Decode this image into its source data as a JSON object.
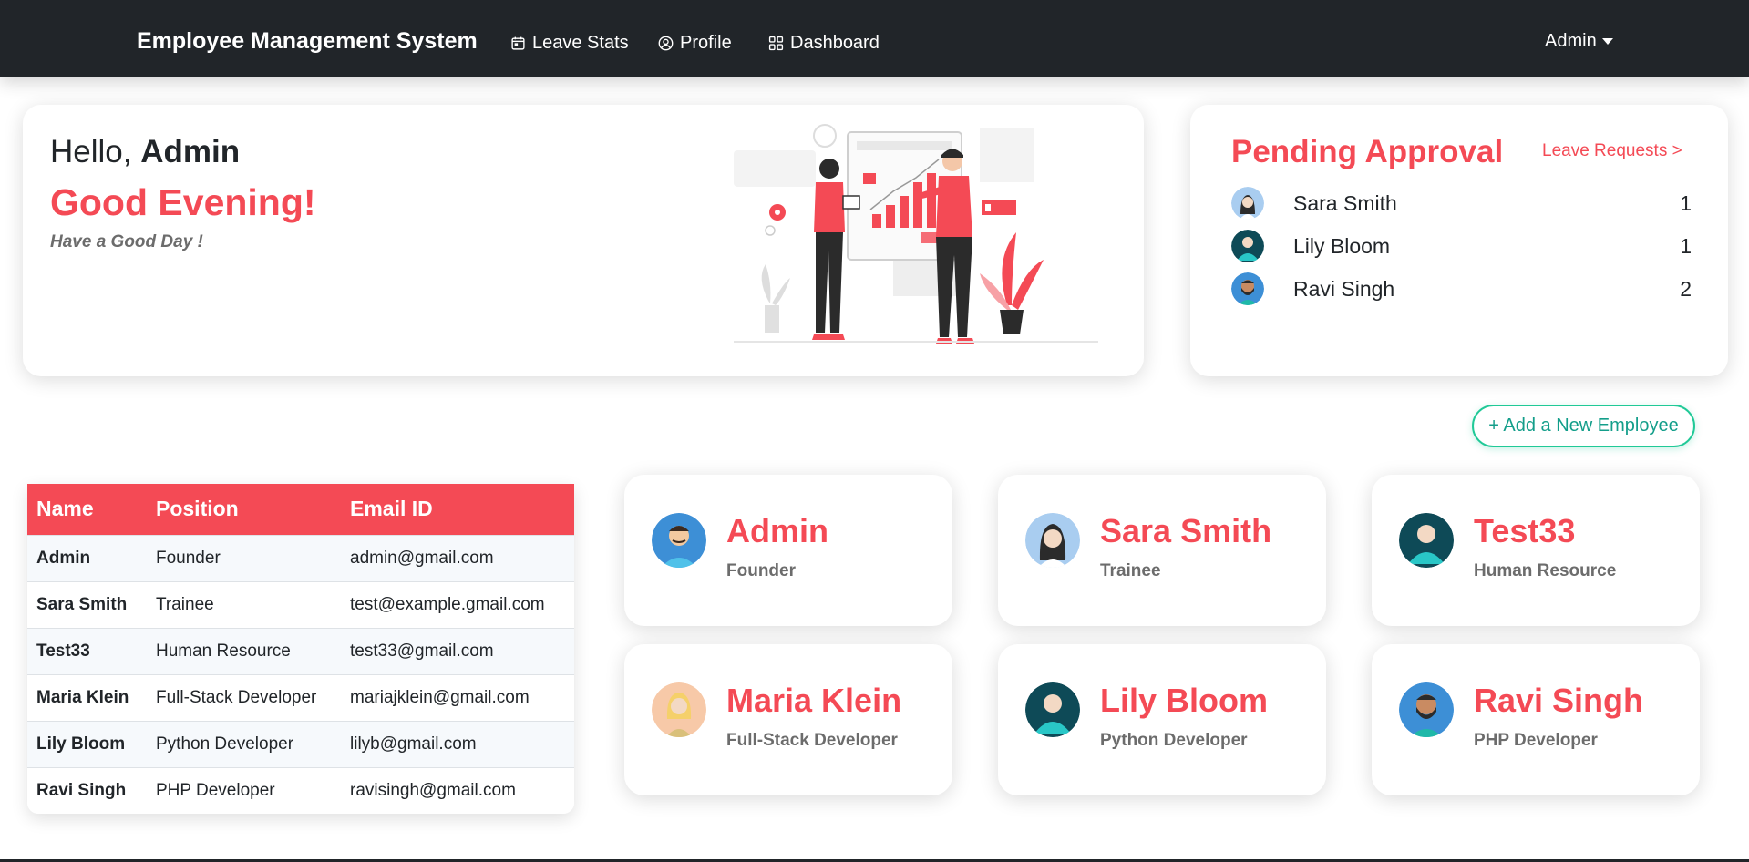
{
  "navbar": {
    "brand": "Employee Management System",
    "links": [
      {
        "label": "Leave Stats",
        "icon": "calendar-icon"
      },
      {
        "label": "Profile",
        "icon": "user-circle-icon"
      },
      {
        "label": "Dashboard",
        "icon": "grid-icon"
      }
    ],
    "user_label": "Admin"
  },
  "greeting": {
    "hello": "Hello, ",
    "user": "Admin",
    "time_greeting": "Good Evening!",
    "tagline": "Have a Good Day !"
  },
  "pending": {
    "title": "Pending Approval",
    "link": "Leave Requests >",
    "items": [
      {
        "name": "Sara Smith",
        "count": "1"
      },
      {
        "name": "Lily Bloom",
        "count": "1"
      },
      {
        "name": "Ravi Singh",
        "count": "2"
      }
    ]
  },
  "add_button": "+ Add a New Employee",
  "table": {
    "headers": [
      "Name",
      "Position",
      "Email ID"
    ],
    "rows": [
      {
        "name": "Admin",
        "position": "Founder",
        "email": "admin@gmail.com"
      },
      {
        "name": "Sara Smith",
        "position": "Trainee",
        "email": "test@example.gmail.com"
      },
      {
        "name": "Test33",
        "position": "Human Resource",
        "email": "test33@gmail.com"
      },
      {
        "name": "Maria Klein",
        "position": "Full-Stack Developer",
        "email": "mariajklein@gmail.com"
      },
      {
        "name": "Lily Bloom",
        "position": "Python Developer",
        "email": "lilyb@gmail.com"
      },
      {
        "name": "Ravi Singh",
        "position": "PHP Developer",
        "email": "ravisingh@gmail.com"
      }
    ]
  },
  "employees": [
    {
      "name": "Admin",
      "position": "Founder"
    },
    {
      "name": "Sara Smith",
      "position": "Trainee"
    },
    {
      "name": "Test33",
      "position": "Human Resource"
    },
    {
      "name": "Maria Klein",
      "position": "Full-Stack Developer"
    },
    {
      "name": "Lily Bloom",
      "position": "Python Developer"
    },
    {
      "name": "Ravi Singh",
      "position": "PHP Developer"
    }
  ],
  "colors": {
    "accent": "#f44a55",
    "navbar": "#212529",
    "teal": "#20c997"
  }
}
